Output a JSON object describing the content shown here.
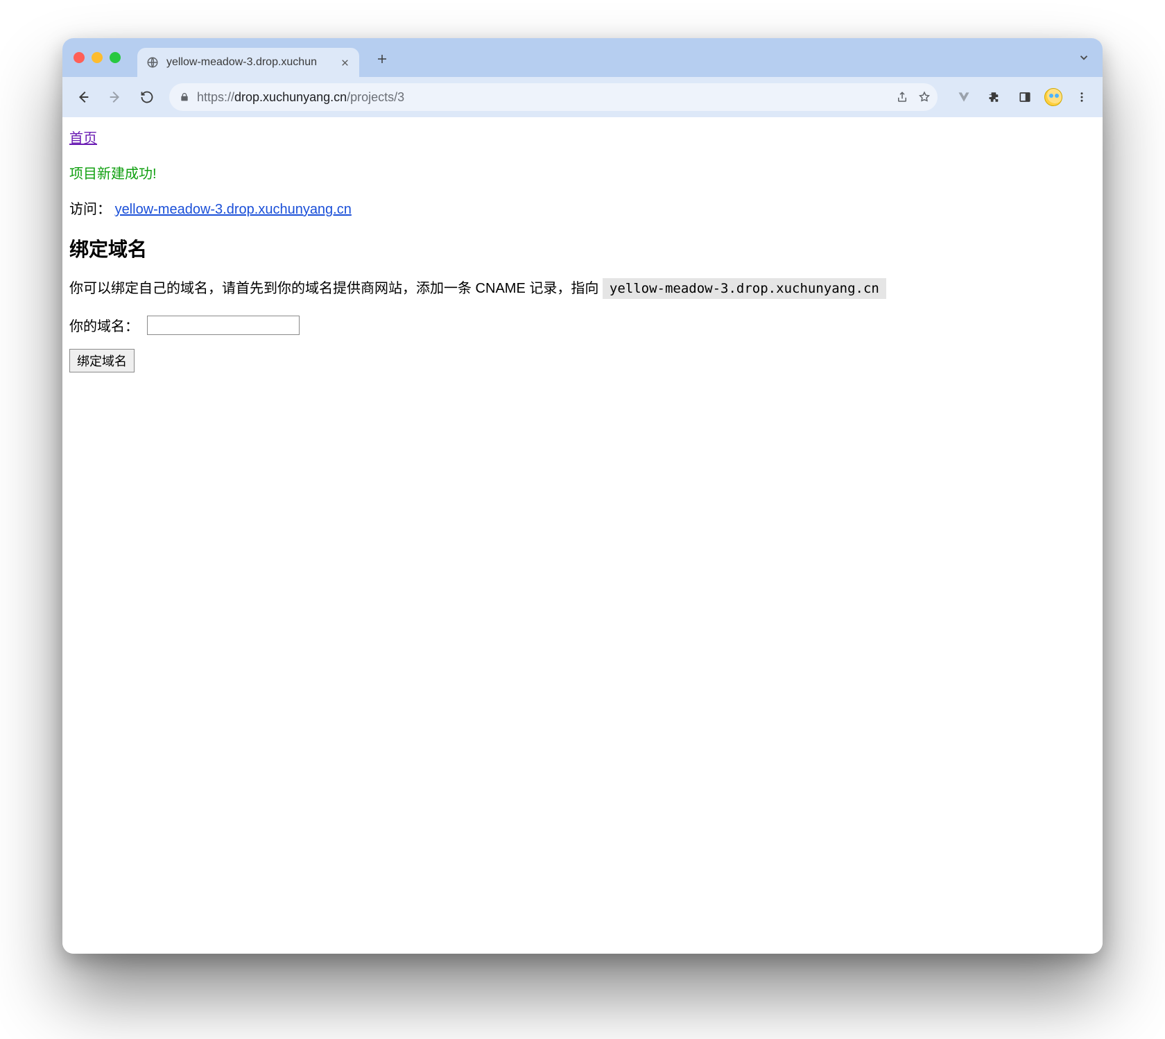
{
  "window": {
    "tab_title": "yellow-meadow-3.drop.xuchun"
  },
  "toolbar": {
    "url_scheme": "https://",
    "url_host": "drop.xuchunyang.cn",
    "url_path": "/projects/3"
  },
  "page": {
    "home_link": "首页",
    "success_message": "项目新建成功!",
    "visit_label": "访问：",
    "visit_link_text": "yellow-meadow-3.drop.xuchunyang.cn",
    "heading": "绑定域名",
    "instruction_prefix": "你可以绑定自己的域名，请首先到你的域名提供商网站，添加一条 CNAME 记录，指向 ",
    "cname_target": "yellow-meadow-3.drop.xuchunyang.cn",
    "form_label": "你的域名：",
    "domain_input_value": "",
    "submit_label": "绑定域名"
  }
}
